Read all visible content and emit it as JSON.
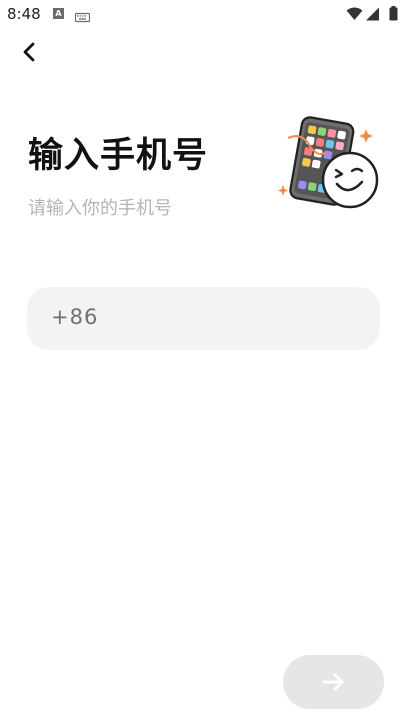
{
  "status_bar": {
    "time": "8:48",
    "notification_icon_letter": "A",
    "icons": [
      "a-notification-icon",
      "keyboard-icon",
      "wifi-icon",
      "signal-icon",
      "battery-icon"
    ]
  },
  "header": {
    "back_icon": "chevron-left-icon"
  },
  "main": {
    "title": "输入手机号",
    "subtitle": "请输入你的手机号",
    "illustration_icon": "phone-smiley-illustration"
  },
  "phone_field": {
    "country_code": "+86",
    "value": "",
    "placeholder": ""
  },
  "footer": {
    "next_icon": "arrow-right-icon",
    "next_button_color": "#e6e6e6"
  },
  "colors": {
    "accent_orange": "#f08a4b",
    "title": "#111111",
    "subtitle": "#b4b4b4",
    "field_bg": "#f3f3f3"
  }
}
